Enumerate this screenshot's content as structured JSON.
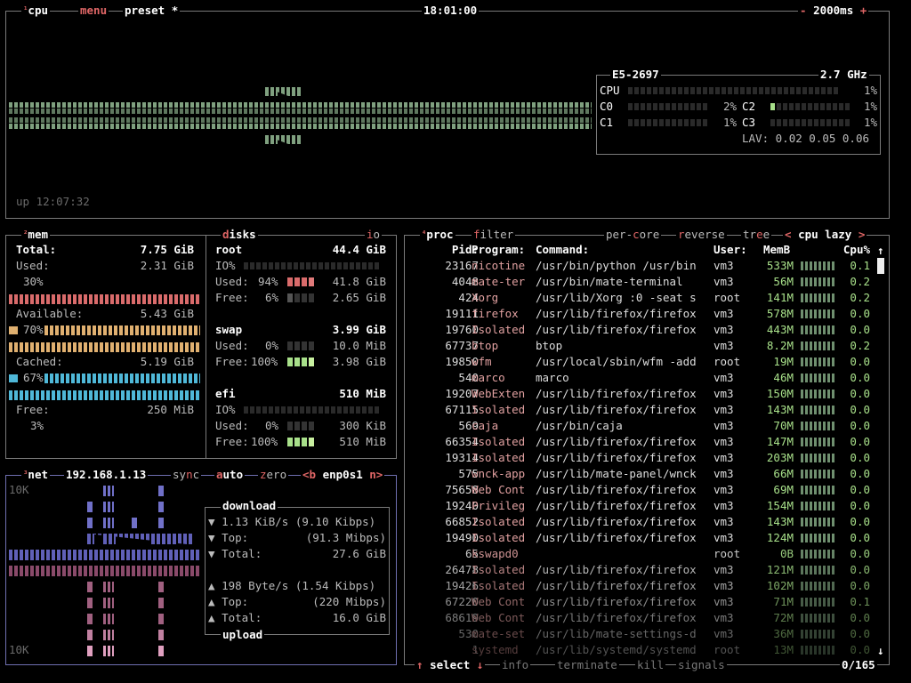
{
  "cpu": {
    "sup": "¹",
    "tab_cpu": "cpu",
    "tab_menu": "menu",
    "tab_preset": "preset",
    "star": "*",
    "time": "18:01:00",
    "interval_minus": "-",
    "interval": "2000ms",
    "interval_plus": "+",
    "uptime": "up 12:07:32",
    "model": "E5-2697",
    "freq": "2.7 GHz",
    "total_label": "CPU",
    "total_pct": "1%",
    "cores": [
      {
        "name": "C0",
        "pct": "2%",
        "level": 0.02
      },
      {
        "name": "C1",
        "pct": "1%",
        "level": 0.01
      },
      {
        "name": "C2",
        "pct": "1%",
        "level": 0.01
      },
      {
        "name": "C3",
        "pct": "1%",
        "level": 0.01
      }
    ],
    "lav_label": "LAV:",
    "lav": "0.02 0.05 0.06"
  },
  "mem": {
    "sup": "²",
    "title": "mem",
    "total_label": "Total:",
    "total": "7.75 GiB",
    "used_label": "Used:",
    "used": "2.31 GiB",
    "used_pct": "30%",
    "avail_label": "Available:",
    "avail": "5.43 GiB",
    "avail_pct": "70%",
    "cached_label": "Cached:",
    "cached": "5.19 GiB",
    "cached_pct": "67%",
    "free_label": "Free:",
    "free": "250 MiB",
    "free_pct": "3%"
  },
  "disks": {
    "title": "disks",
    "io": "io",
    "root": {
      "name": "root",
      "size": "44.4 GiB",
      "io_label": "IO%",
      "used_label": "Used:",
      "used_pct": "94%",
      "used": "41.8 GiB",
      "free_label": "Free:",
      "free_pct": "6%",
      "free": "2.65 GiB"
    },
    "swap": {
      "name": "swap",
      "size": "3.99 GiB",
      "used_label": "Used:",
      "used_pct": "0%",
      "used": "10.0 MiB",
      "free_label": "Free:",
      "free_pct": "100%",
      "free": "3.98 GiB"
    },
    "efi": {
      "name": "efi",
      "size": "510 MiB",
      "io_label": "IO%",
      "used_label": "Used:",
      "used_pct": "0%",
      "used": "300 KiB",
      "free_label": "Free:",
      "free_pct": "100%",
      "free": "510 MiB"
    }
  },
  "net": {
    "sup": "³",
    "title": "net",
    "ip": "192.168.1.13",
    "sync": "sync",
    "auto": "auto",
    "zero": "zero",
    "prev": "<b",
    "iface": "enp0s1",
    "next": "n>",
    "scale_top": "10K",
    "scale_bottom": "10K",
    "download_title": "download",
    "upload_title": "upload",
    "down_rate": "1.13 KiB/s",
    "down_bits": "(9.10 Kibps)",
    "down_top_label": "Top:",
    "down_top": "(91.3 Mibps)",
    "down_total_label": "Total:",
    "down_total": "27.6 GiB",
    "up_rate": "198 Byte/s",
    "up_bits": "(1.54 Kibps)",
    "up_top_label": "Top:",
    "up_top": "(220 Mibps)",
    "up_total_label": "Total:",
    "up_total": "16.0 GiB"
  },
  "proc": {
    "sup": "⁴",
    "title": "proc",
    "filter": "filter",
    "per_core": "per-core",
    "reverse": "reverse",
    "tree": "tree",
    "sort_prev": "<",
    "sort": "cpu lazy",
    "sort_next": ">",
    "headers": {
      "pid": "Pid:",
      "program": "Program:",
      "command": "Command:",
      "user": "User:",
      "mem": "MemB",
      "cpu": "Cpu%"
    },
    "rows": [
      {
        "pid": "23167",
        "program": "nicotine",
        "command": "/usr/bin/python /usr/bin",
        "user": "vm3",
        "mem": "533M",
        "cpu": "0.1"
      },
      {
        "pid": "4048",
        "program": "mate-ter",
        "command": "/usr/bin/mate-terminal",
        "user": "vm3",
        "mem": "56M",
        "cpu": "0.2"
      },
      {
        "pid": "424",
        "program": "Xorg",
        "command": "/usr/lib/Xorg :0 -seat s",
        "user": "root",
        "mem": "141M",
        "cpu": "0.2"
      },
      {
        "pid": "19111",
        "program": "firefox",
        "command": "/usr/lib/firefox/firefox",
        "user": "vm3",
        "mem": "578M",
        "cpu": "0.0"
      },
      {
        "pid": "19760",
        "program": "Isolated",
        "command": "/usr/lib/firefox/firefox",
        "user": "vm3",
        "mem": "443M",
        "cpu": "0.0"
      },
      {
        "pid": "67737",
        "program": "btop",
        "command": "btop",
        "user": "vm3",
        "mem": "8.2M",
        "cpu": "0.2"
      },
      {
        "pid": "19850",
        "program": "wfm",
        "command": "/usr/local/sbin/wfm -add",
        "user": "root",
        "mem": "19M",
        "cpu": "0.0"
      },
      {
        "pid": "540",
        "program": "marco",
        "command": "marco",
        "user": "vm3",
        "mem": "46M",
        "cpu": "0.0"
      },
      {
        "pid": "19207",
        "program": "WebExten",
        "command": "/usr/lib/firefox/firefox",
        "user": "vm3",
        "mem": "150M",
        "cpu": "0.0"
      },
      {
        "pid": "67115",
        "program": "Isolated",
        "command": "/usr/lib/firefox/firefox",
        "user": "vm3",
        "mem": "143M",
        "cpu": "0.0"
      },
      {
        "pid": "569",
        "program": "caja",
        "command": "/usr/bin/caja",
        "user": "vm3",
        "mem": "70M",
        "cpu": "0.0"
      },
      {
        "pid": "66354",
        "program": "Isolated",
        "command": "/usr/lib/firefox/firefox",
        "user": "vm3",
        "mem": "147M",
        "cpu": "0.0"
      },
      {
        "pid": "19314",
        "program": "Isolated",
        "command": "/usr/lib/firefox/firefox",
        "user": "vm3",
        "mem": "203M",
        "cpu": "0.0"
      },
      {
        "pid": "575",
        "program": "wnck-app",
        "command": "/usr/lib/mate-panel/wnck",
        "user": "vm3",
        "mem": "66M",
        "cpu": "0.0"
      },
      {
        "pid": "75658",
        "program": "Web Cont",
        "command": "/usr/lib/firefox/firefox",
        "user": "vm3",
        "mem": "69M",
        "cpu": "0.0"
      },
      {
        "pid": "19240",
        "program": "Privileg",
        "command": "/usr/lib/firefox/firefox",
        "user": "vm3",
        "mem": "154M",
        "cpu": "0.0"
      },
      {
        "pid": "66852",
        "program": "Isolated",
        "command": "/usr/lib/firefox/firefox",
        "user": "vm3",
        "mem": "143M",
        "cpu": "0.0"
      },
      {
        "pid": "19490",
        "program": "Isolated",
        "command": "/usr/lib/firefox/firefox",
        "user": "vm3",
        "mem": "124M",
        "cpu": "0.0"
      },
      {
        "pid": "65",
        "program": "kswapd0",
        "command": "",
        "user": "root",
        "mem": "0B",
        "cpu": "0.0"
      },
      {
        "pid": "26478",
        "program": "Isolated",
        "command": "/usr/lib/firefox/firefox",
        "user": "vm3",
        "mem": "121M",
        "cpu": "0.0"
      },
      {
        "pid": "19426",
        "program": "Isolated",
        "command": "/usr/lib/firefox/firefox",
        "user": "vm3",
        "mem": "102M",
        "cpu": "0.0"
      },
      {
        "pid": "67220",
        "program": "Web Cont",
        "command": "/usr/lib/firefox/firefox",
        "user": "vm3",
        "mem": "71M",
        "cpu": "0.1"
      },
      {
        "pid": "68619",
        "program": "Web Cont",
        "command": "/usr/lib/firefox/firefox",
        "user": "vm3",
        "mem": "72M",
        "cpu": "0.0"
      },
      {
        "pid": "530",
        "program": "mate-set",
        "command": "/usr/lib/mate-settings-d",
        "user": "vm3",
        "mem": "36M",
        "cpu": "0.0"
      },
      {
        "pid": "1",
        "program": "systemd",
        "command": "/usr/lib/systemd/systemd",
        "user": "root",
        "mem": "13M",
        "cpu": "0.0"
      }
    ],
    "select": "select",
    "info": "info",
    "terminate": "terminate",
    "kill": "kill",
    "signals": "signals",
    "count": "0/165",
    "arrow_up": "↑",
    "arrow_down": "↓",
    "select_up": "↑",
    "select_down": "↓"
  },
  "colors": {
    "accent": "#e06666",
    "cpu_graph": "#7fa07f",
    "mem_used": "#d96b6b",
    "mem_avail": "#e0b070",
    "mem_cached": "#4fb8d8",
    "net_down": "#7070c8",
    "net_up": "#a06080"
  }
}
